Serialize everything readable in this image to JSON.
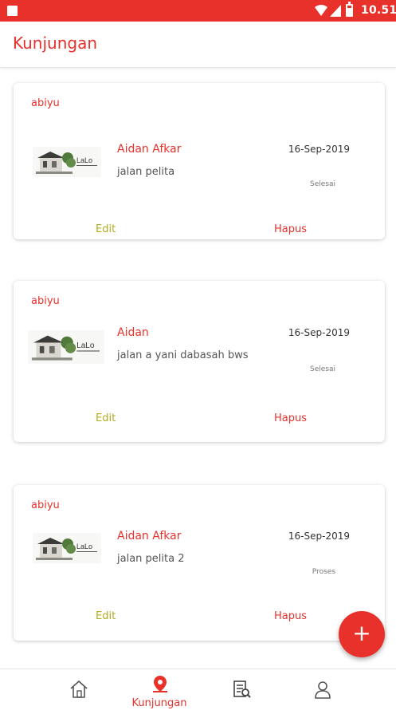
{
  "statusbar": {
    "time": "10.51"
  },
  "appbar": {
    "title": "Kunjungan"
  },
  "cards": [
    {
      "owner": "abiyu",
      "name": "Aidan Afkar",
      "date": "16-Sep-2019",
      "address": "jalan pelita",
      "status": "Selesai",
      "edit_label": "Edit",
      "delete_label": "Hapus"
    },
    {
      "owner": "abiyu",
      "name": "Aidan",
      "date": "16-Sep-2019",
      "address": "jalan a yani dabasah bws",
      "status": "Selesai",
      "edit_label": "Edit",
      "delete_label": "Hapus"
    },
    {
      "owner": "abiyu",
      "name": "Aidan Afkar",
      "date": "16-Sep-2019",
      "address": "jalan pelita 2",
      "status": "Proses",
      "edit_label": "Edit",
      "delete_label": "Hapus"
    }
  ],
  "fab": {
    "icon": "plus-icon",
    "label": "+"
  },
  "bottom_nav": {
    "items": [
      {
        "icon": "home-icon",
        "label": ""
      },
      {
        "icon": "location-pin-icon",
        "label": "Kunjungan",
        "active": true
      },
      {
        "icon": "document-search-icon",
        "label": ""
      },
      {
        "icon": "user-icon",
        "label": ""
      }
    ]
  },
  "colors": {
    "primary": "#e8312b",
    "edit": "#b1ad1f",
    "text": "#555555"
  }
}
